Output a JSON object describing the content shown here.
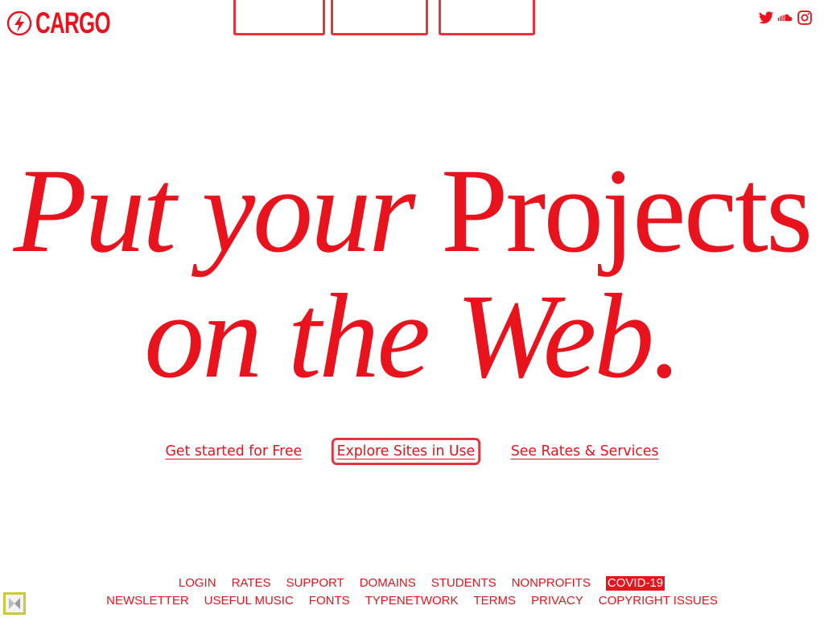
{
  "header": {
    "logo_text": "CARGO",
    "social": [
      "twitter-icon",
      "soundcloud-icon",
      "instagram-icon"
    ]
  },
  "hero": {
    "line1_italic": "Put your",
    "line1_roman": "Projects",
    "line2_italic": "on the Web."
  },
  "cta": {
    "get_started": "Get started for Free",
    "explore": "Explore Sites in Use",
    "rates": "See Rates & Services"
  },
  "footer": {
    "row1": [
      "LOGIN",
      "RATES",
      "SUPPORT",
      "DOMAINS",
      "STUDENTS",
      "NONPROFITS",
      "COVID-19"
    ],
    "row2": [
      "NEWSLETTER",
      "USEFUL MUSIC",
      "FONTS",
      "TYPENETWORK",
      "TERMS",
      "PRIVACY",
      "COPYRIGHT ISSUES"
    ]
  },
  "colors": {
    "accent": "#e8131c",
    "background": "#ffffff"
  }
}
